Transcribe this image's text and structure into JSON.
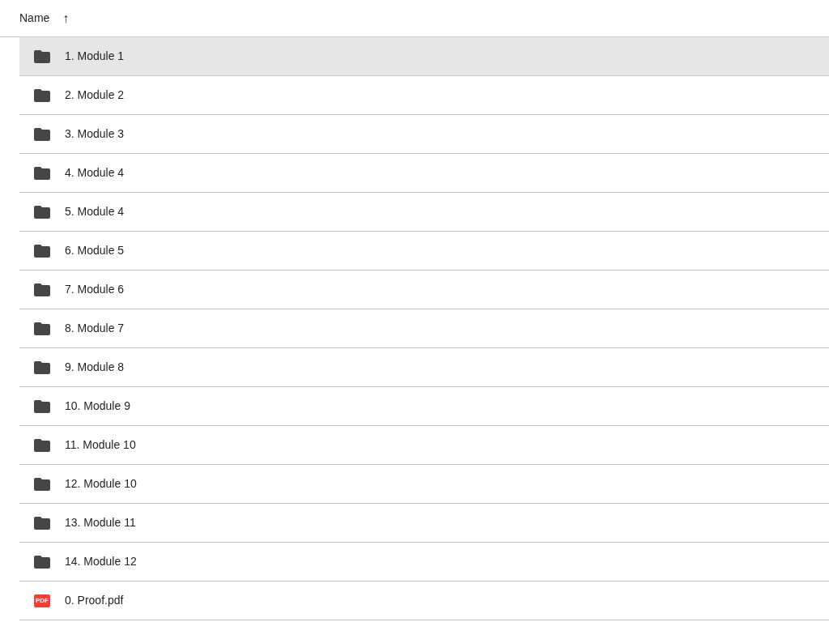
{
  "header": {
    "column": "Name",
    "sort_arrow": "↑"
  },
  "items": [
    {
      "kind": "folder",
      "name": "1. Module 1",
      "selected": true
    },
    {
      "kind": "folder",
      "name": "2. Module 2",
      "selected": false
    },
    {
      "kind": "folder",
      "name": "3. Module 3",
      "selected": false
    },
    {
      "kind": "folder",
      "name": "4. Module 4",
      "selected": false
    },
    {
      "kind": "folder",
      "name": "5. Module 4",
      "selected": false
    },
    {
      "kind": "folder",
      "name": "6. Module 5",
      "selected": false
    },
    {
      "kind": "folder",
      "name": "7. Module 6",
      "selected": false
    },
    {
      "kind": "folder",
      "name": "8. Module 7",
      "selected": false
    },
    {
      "kind": "folder",
      "name": "9. Module 8",
      "selected": false
    },
    {
      "kind": "folder",
      "name": "10. Module 9",
      "selected": false
    },
    {
      "kind": "folder",
      "name": "11. Module 10",
      "selected": false
    },
    {
      "kind": "folder",
      "name": "12. Module 10",
      "selected": false
    },
    {
      "kind": "folder",
      "name": "13. Module 11",
      "selected": false
    },
    {
      "kind": "folder",
      "name": "14. Module 12",
      "selected": false
    },
    {
      "kind": "pdf",
      "name": "0. Proof.pdf",
      "icon_text": "PDF",
      "selected": false
    }
  ]
}
